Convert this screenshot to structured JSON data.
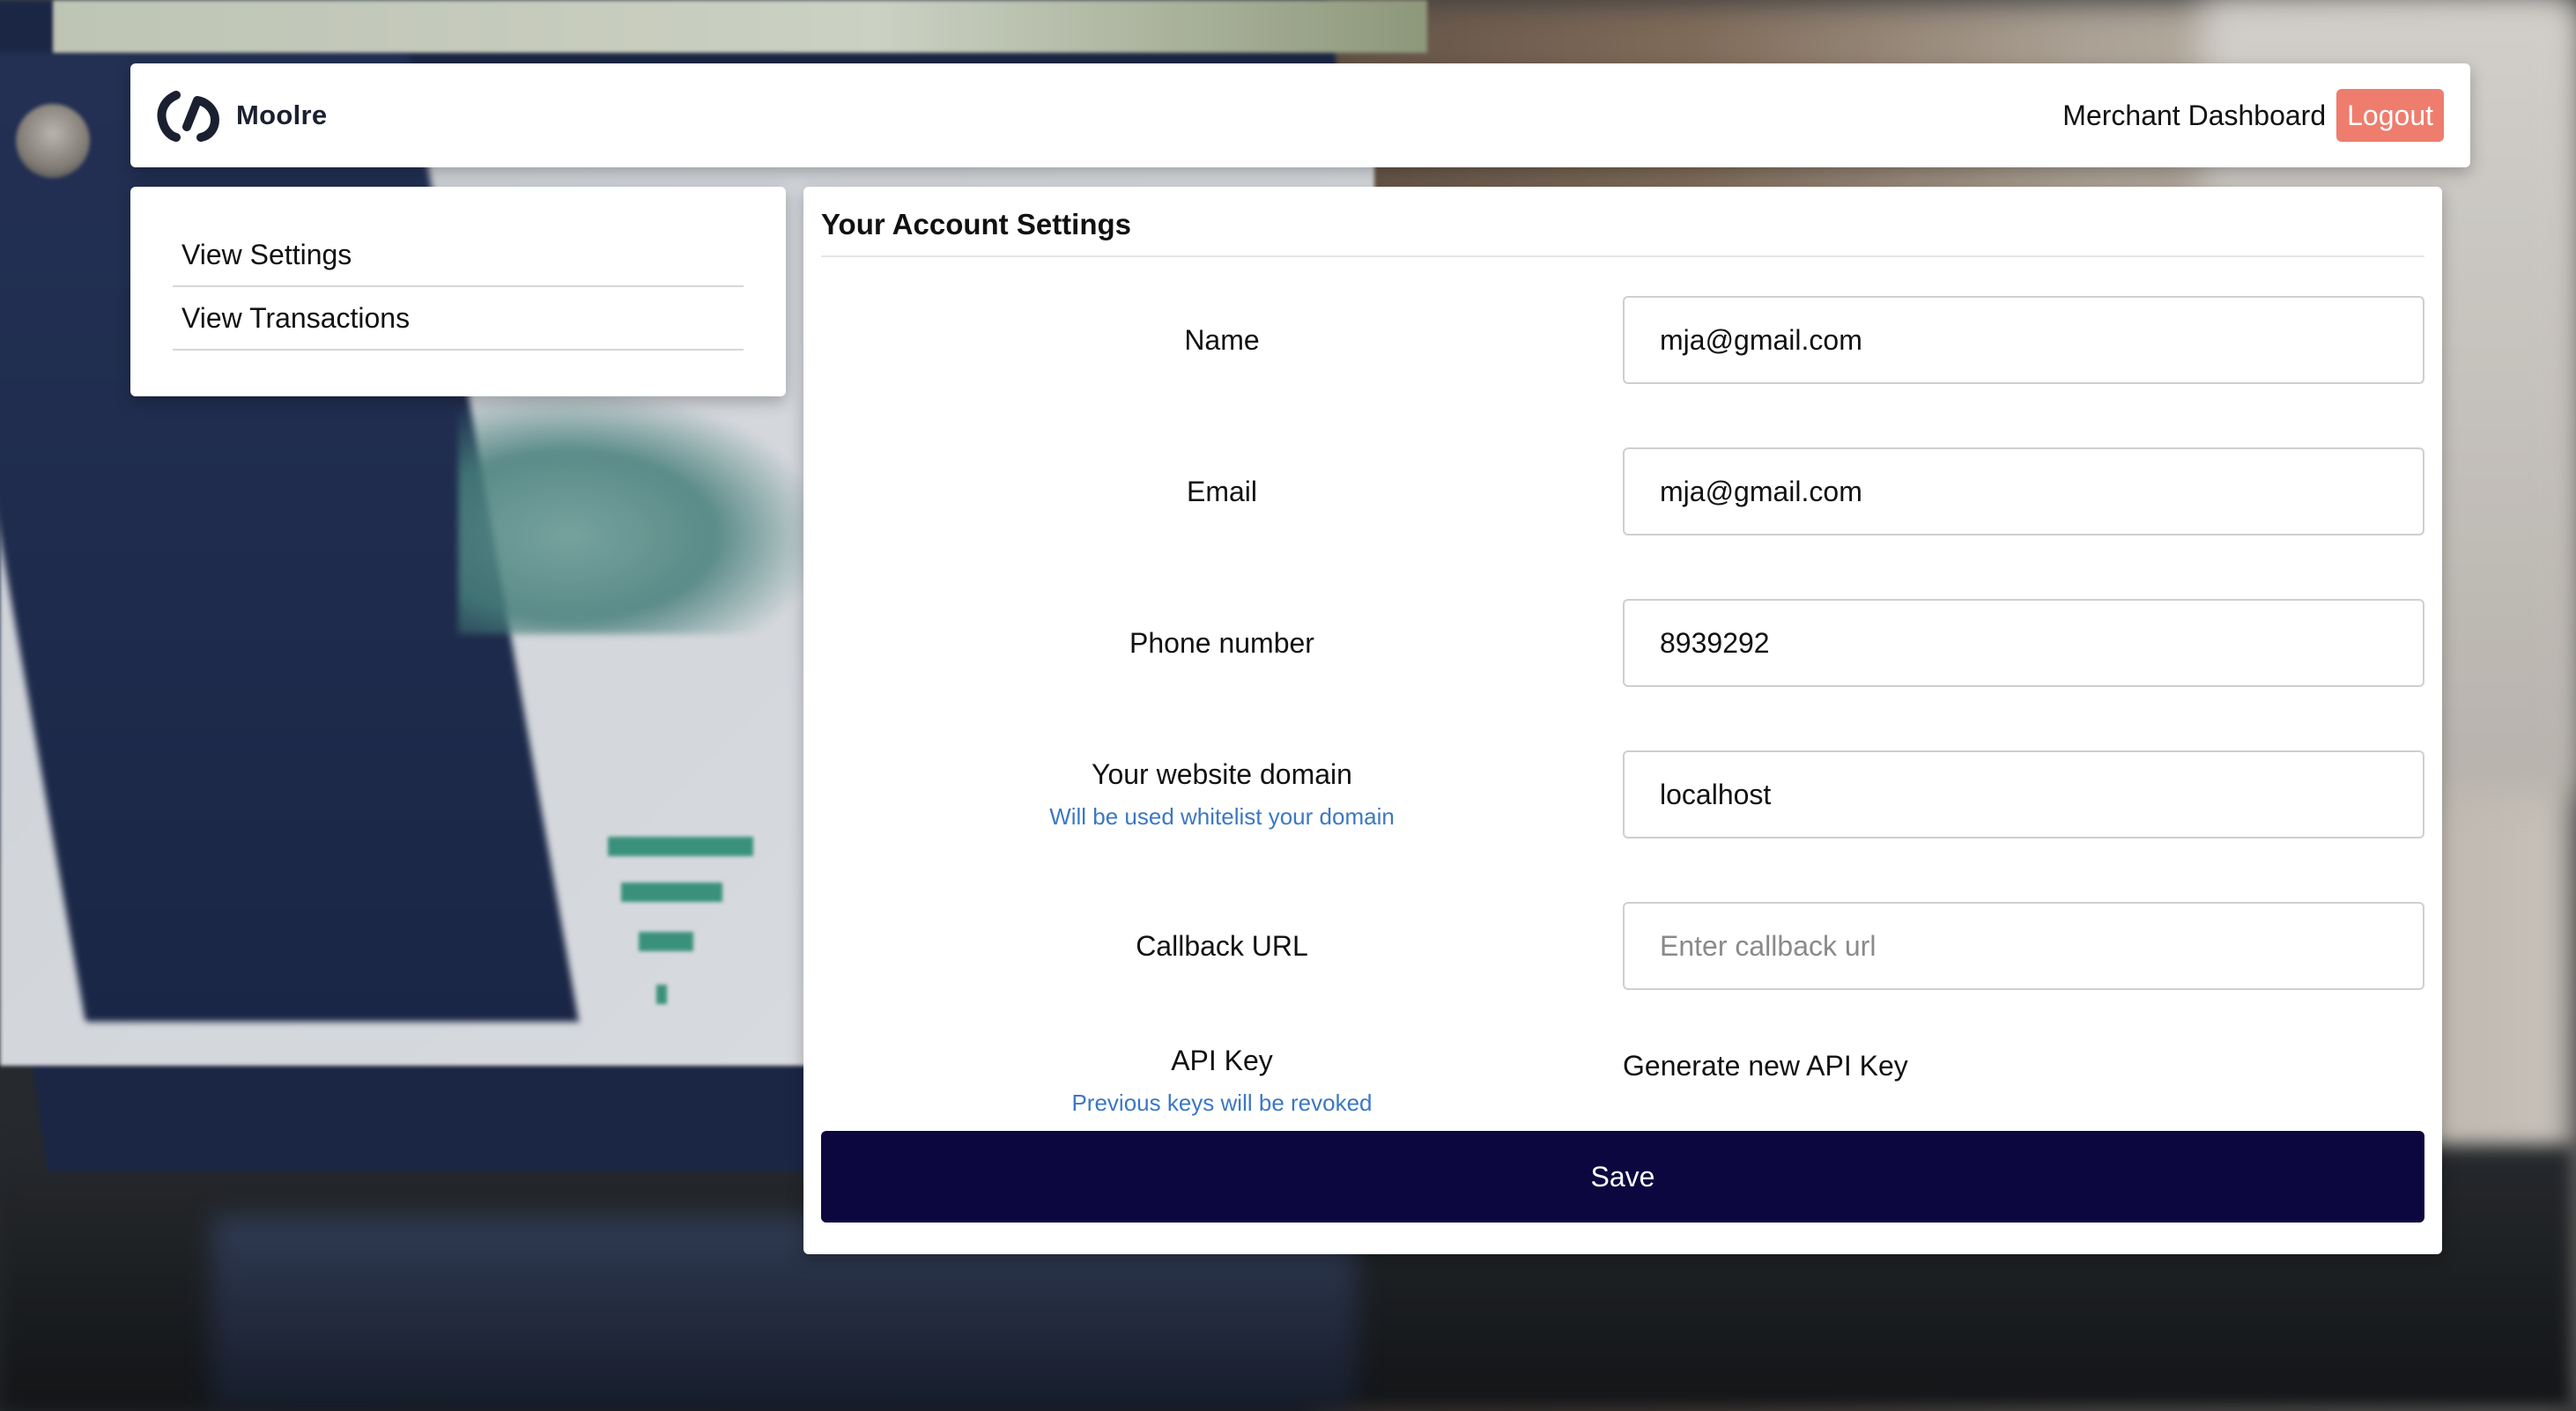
{
  "colors": {
    "logout_button": "#ef7d6d",
    "save_button": "#0d0740",
    "hint_text": "#3b78c4",
    "brand": "#1b2030"
  },
  "navbar": {
    "brand_name": "Moolre",
    "brand_icon": "moolre-logo-icon",
    "dashboard_link": "Merchant Dashboard",
    "logout_label": "Logout"
  },
  "sidebar": {
    "items": [
      {
        "label": "View Settings"
      },
      {
        "label": "View Transactions"
      }
    ]
  },
  "settings": {
    "title": "Your Account Settings",
    "fields": {
      "name": {
        "label": "Name",
        "value": "mja@gmail.com"
      },
      "email": {
        "label": "Email",
        "value": "mja@gmail.com"
      },
      "phone": {
        "label": "Phone number",
        "value": "8939292"
      },
      "domain": {
        "label": "Your website domain",
        "hint": "Will be used whitelist your domain",
        "value": "localhost"
      },
      "callback": {
        "label": "Callback URL",
        "value": "",
        "placeholder": "Enter callback url"
      },
      "api_key": {
        "label": "API Key",
        "hint": "Previous keys will be revoked",
        "action": "Generate new API Key"
      }
    },
    "save_label": "Save"
  }
}
